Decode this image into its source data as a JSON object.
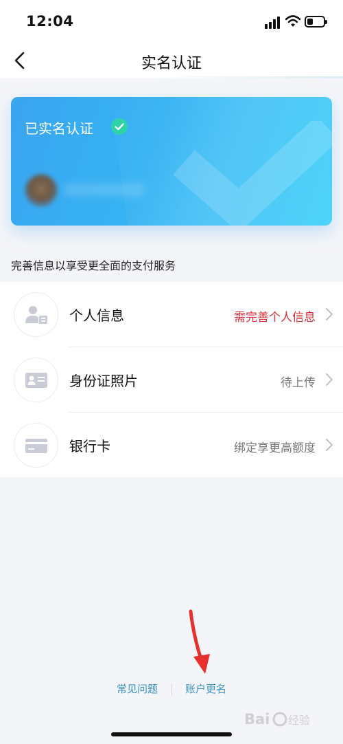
{
  "status_bar": {
    "time": "12:04"
  },
  "nav": {
    "title": "实名认证"
  },
  "card": {
    "verified_label": "已实名认证"
  },
  "hint": "完善信息以享受更全面的支付服务",
  "items": [
    {
      "label": "个人信息",
      "status": "需完善个人信息",
      "status_color": "#d6303a",
      "icon": "person-id-icon"
    },
    {
      "label": "身份证照片",
      "status": "待上传",
      "status_color": "#777777",
      "icon": "id-card-icon"
    },
    {
      "label": "银行卡",
      "status": "绑定享更高额度",
      "status_color": "#777777",
      "icon": "bank-card-icon"
    }
  ],
  "footer": {
    "faq": "常见问题",
    "rename": "账户更名"
  },
  "colors": {
    "accent": "#3aa5f0",
    "verified": "#2ed3a5",
    "link": "#3a93c8",
    "warning": "#d6303a",
    "annotation_arrow": "#e8302f"
  },
  "watermark": {
    "text": "Baidu 经验"
  }
}
